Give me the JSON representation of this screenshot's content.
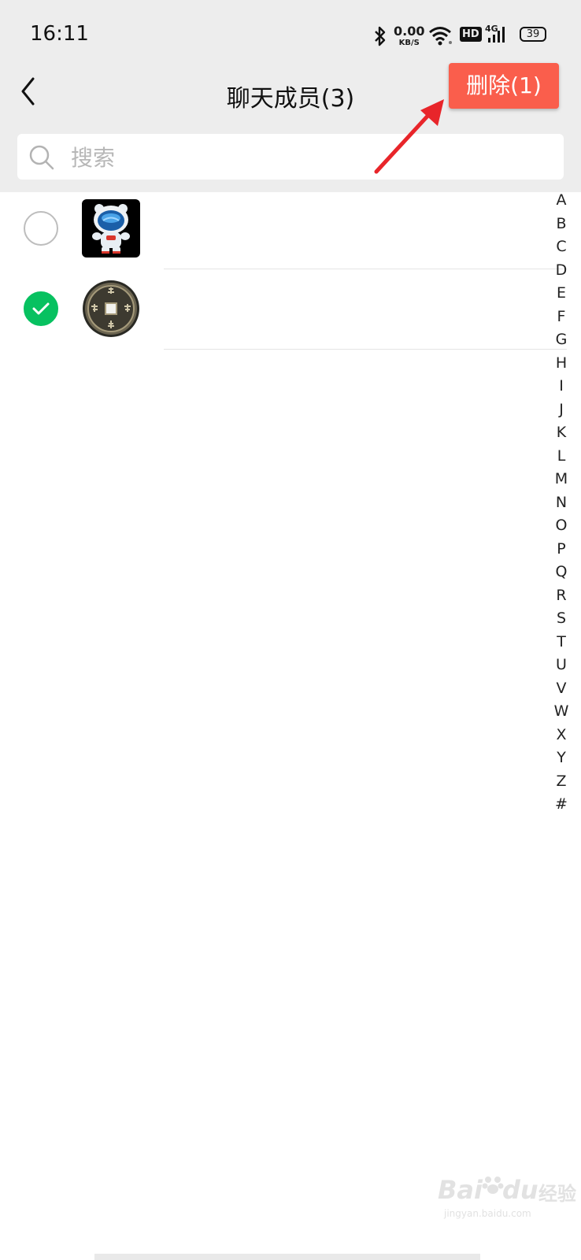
{
  "status_bar": {
    "time": "16:11",
    "net_speed_value": "0.00",
    "net_speed_unit": "KB/S",
    "network_type": "4G",
    "hd_label": "HD",
    "battery": "39"
  },
  "header": {
    "title": "聊天成员(3)",
    "delete_label": "删除(1)"
  },
  "search": {
    "placeholder": "搜索"
  },
  "members": [
    {
      "selected": false,
      "avatar_icon": "astronaut-avatar"
    },
    {
      "selected": true,
      "avatar_icon": "coin-avatar"
    }
  ],
  "index_letters": [
    "A",
    "B",
    "C",
    "D",
    "E",
    "F",
    "G",
    "H",
    "I",
    "J",
    "K",
    "L",
    "M",
    "N",
    "O",
    "P",
    "Q",
    "R",
    "S",
    "T",
    "U",
    "V",
    "W",
    "X",
    "Y",
    "Z",
    "#"
  ],
  "colors": {
    "accent_red": "#fa5e4c",
    "check_green": "#07c160",
    "header_bg": "#ededed"
  },
  "watermark": {
    "brand": "Bai",
    "brand_suffix": "du",
    "product": "经验",
    "url": "jingyan.baidu.com"
  }
}
